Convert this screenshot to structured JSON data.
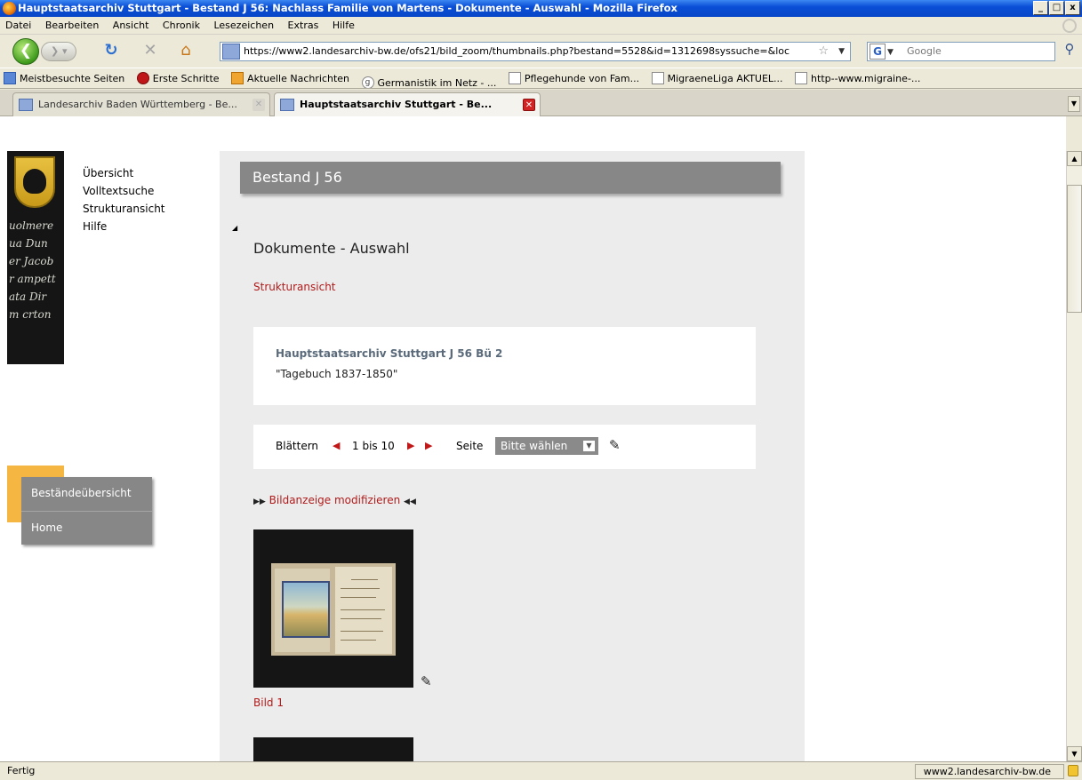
{
  "window": {
    "title": "Hauptstaatsarchiv Stuttgart - Bestand J 56: Nachlass Familie von Martens - Dokumente - Auswahl - Mozilla Firefox",
    "buttons": [
      "_",
      " ",
      "x"
    ]
  },
  "menu": {
    "items": [
      "Datei",
      "Bearbeiten",
      "Ansicht",
      "Chronik",
      "Lesezeichen",
      "Extras",
      "Hilfe"
    ]
  },
  "toolbar": {
    "url": "https://www2.landesarchiv-bw.de/ofs21/bild_zoom/thumbnails.php?bestand=5528&id=1312698syssuche=&loc",
    "search_placeholder": "Google"
  },
  "bookmarks": [
    {
      "label": "Meistbesuchte Seiten",
      "icon": "a"
    },
    {
      "label": "Erste Schritte",
      "icon": "b"
    },
    {
      "label": "Aktuelle Nachrichten",
      "icon": "c"
    },
    {
      "label": "Germanistik im Netz - ...",
      "icon": "d"
    },
    {
      "label": "Pflegehunde von Fam...",
      "icon": ""
    },
    {
      "label": "MigraeneLiga AKTUEL...",
      "icon": ""
    },
    {
      "label": "http--www.migraine-...",
      "icon": ""
    }
  ],
  "tabs": [
    {
      "label": "Landesarchiv Baden Württemberg - Be...",
      "active": false
    },
    {
      "label": "Hauptstaatsarchiv Stuttgart - Be...",
      "active": true
    }
  ],
  "sidebar": {
    "nav": [
      "Übersicht",
      "Volltextsuche",
      "Strukturansicht",
      "Hilfe"
    ],
    "menu": [
      "Beständeübersicht",
      "Home"
    ]
  },
  "main": {
    "header": "Bestand J 56",
    "title": "Dokumente - Auswahl",
    "structure_link": "Strukturansicht",
    "record": {
      "signature": "Hauptstaatsarchiv Stuttgart J 56 Bü 2",
      "title": "\"Tagebuch 1837-1850\""
    },
    "pager": {
      "label": "Blättern",
      "range": "1 bis 10",
      "page_label": "Seite",
      "select_value": "Bitte wählen"
    },
    "modify_link": "Bildanzeige modifizieren",
    "images": [
      {
        "label": "Bild 1"
      }
    ]
  },
  "status": {
    "left": "Fertig",
    "right": "www2.landesarchiv-bw.de"
  }
}
